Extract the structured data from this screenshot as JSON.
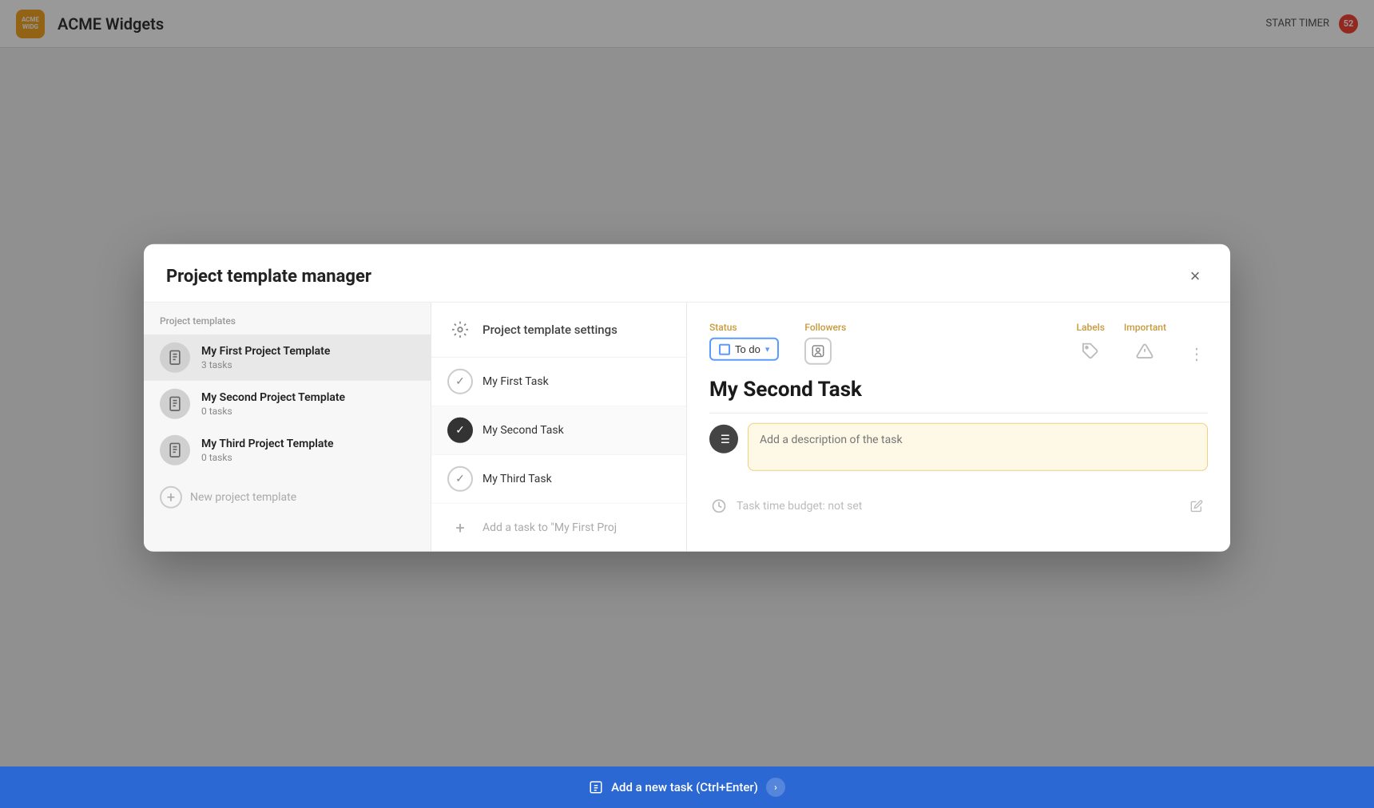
{
  "app": {
    "title": "ACME Widgets",
    "logo_text": "ACME\nWIDG",
    "notification_count": "52",
    "start_timer": "START TIMER"
  },
  "modal": {
    "title": "Project template manager",
    "close_label": "×",
    "section_label": "Project templates",
    "new_template_label": "New project template"
  },
  "templates": [
    {
      "name": "My First Project Template",
      "count": "3 tasks"
    },
    {
      "name": "My Second Project Template",
      "count": "0 tasks"
    },
    {
      "name": "My Third Project Template",
      "count": "0 tasks"
    }
  ],
  "tasks_panel": {
    "settings_label": "Project template settings",
    "add_task_label": "Add a task to \"My First Proj",
    "tasks": [
      {
        "name": "My First Task",
        "state": "checked"
      },
      {
        "name": "My Second Task",
        "state": "completed"
      },
      {
        "name": "My Third Task",
        "state": "checked"
      }
    ]
  },
  "detail": {
    "task_title": "My Second Task",
    "status_label": "Status",
    "status_value": "To do",
    "followers_label": "Followers",
    "labels_label": "Labels",
    "important_label": "Important",
    "description_placeholder": "Add a description of the task",
    "time_budget_label": "Task time budget: not set"
  },
  "bottom_bar": {
    "label": "Add a new task (Ctrl+Enter)"
  }
}
